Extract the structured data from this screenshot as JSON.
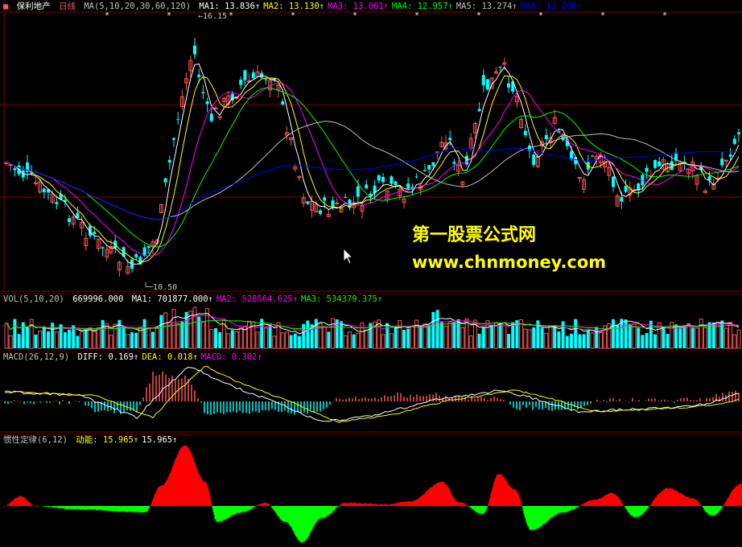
{
  "stock": {
    "name": "保利地产",
    "period": "日线"
  },
  "ma_panel": {
    "label": "MA(5,10,20,30,60,120)",
    "items": [
      {
        "key": "MA1",
        "text": "MA1: 13.836",
        "color": "#ffffff"
      },
      {
        "key": "MA2",
        "text": "MA2: 13.130",
        "color": "#ffff00"
      },
      {
        "key": "MA3",
        "text": "MA3: 13.061",
        "color": "#ff00ff"
      },
      {
        "key": "MA4",
        "text": "MA4: 12.957",
        "color": "#00ff00"
      },
      {
        "key": "MA5",
        "text": "MA5: 13.274",
        "color": "#c0c0c0"
      },
      {
        "key": "MA6",
        "text": "MA6: 13.200",
        "color": "#0000ff"
      }
    ],
    "high_label": "16.15",
    "low_label": "10.50"
  },
  "vol_panel": {
    "label": "VOL(5,10,20)",
    "value": "669996.000",
    "items": [
      {
        "text": "MA1: 701877.000",
        "color": "#ffffff"
      },
      {
        "text": "MA2: 528564.625",
        "color": "#ff00ff"
      },
      {
        "text": "MA3: 534379.375",
        "color": "#00ff00"
      }
    ]
  },
  "macd_panel": {
    "label": "MACD(26,12,9)",
    "items": [
      {
        "text": "DIFF: 0.169",
        "color": "#ffffff"
      },
      {
        "text": "DEA: 0.018",
        "color": "#ffff00"
      },
      {
        "text": "MACD: 0.302",
        "color": "#ff00ff"
      }
    ]
  },
  "inertia_panel": {
    "label": "惯性定律(6,12)",
    "items": [
      {
        "text": "动能: 15.965",
        "color": "#ffff00"
      },
      {
        "text": "15.965",
        "color": "#ffffff"
      }
    ]
  },
  "watermark": {
    "line1": "第一股票公式网",
    "line2": "www.chnmoney.com"
  },
  "arrow_glyph": "↑",
  "colors": {
    "up": "#ff5555",
    "down": "#00ffff",
    "grid": "#800000",
    "pos": "#ff0000",
    "neg": "#00ff00"
  }
}
